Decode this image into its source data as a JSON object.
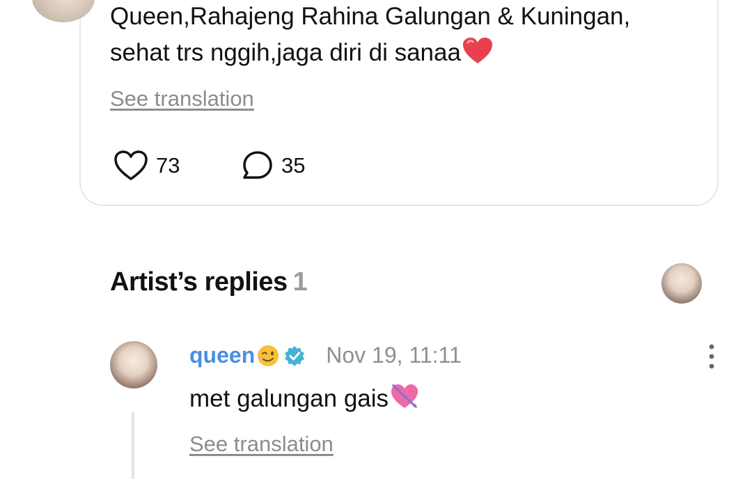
{
  "post": {
    "text_line1": "Queen,Rahajeng Rahina Galungan & Kuningan,",
    "text_line2": "sehat trs nggih,jaga diri di sanaa",
    "see_translation": "See translation",
    "likes": "73",
    "comments": "35"
  },
  "artist_replies": {
    "title": "Artist’s replies",
    "count": "1"
  },
  "reply": {
    "name": "queen",
    "date": "Nov 19, 11:11",
    "text": "met galungan gais",
    "see_translation": "See translation"
  },
  "colors": {
    "accent_blue": "#4a90e2",
    "verified_badge": "#45b3d6",
    "muted_gray": "#8c8c8c"
  },
  "icons": [
    "heart-icon",
    "comment-bubble-icon",
    "verified-badge-icon",
    "more-vertical-icon",
    "red-heart-emoji",
    "wink-emoji",
    "heart-arrow-emoji"
  ]
}
